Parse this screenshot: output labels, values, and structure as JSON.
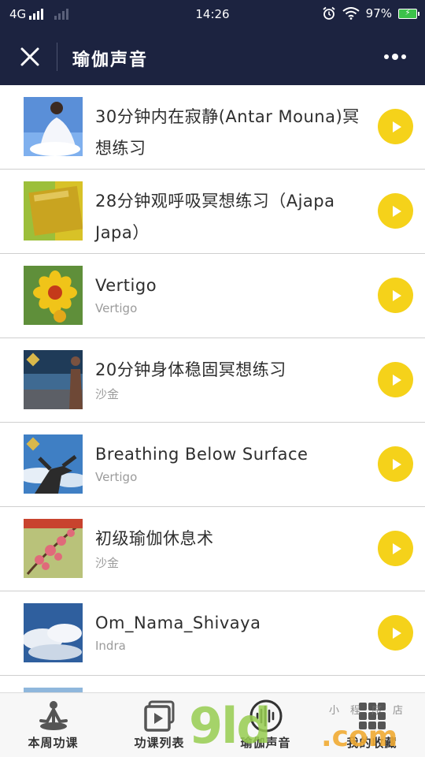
{
  "status_bar": {
    "network": "4G",
    "time": "14:26",
    "battery": "97%"
  },
  "header": {
    "title": "瑜伽声音"
  },
  "tracks": [
    {
      "title": "30分钟内在寂静(Antar Mouna)冥想练习",
      "subtitle": ""
    },
    {
      "title": "28分钟观呼吸冥想练习（Ajapa Japa）",
      "subtitle": ""
    },
    {
      "title": "Vertigo",
      "subtitle": "Vertigo"
    },
    {
      "title": "20分钟身体稳固冥想练习",
      "subtitle": "沙金"
    },
    {
      "title": "Breathing Below Surface",
      "subtitle": "Vertigo"
    },
    {
      "title": "初级瑜伽休息术",
      "subtitle": "沙金"
    },
    {
      "title": "Om_Nama_Shivaya",
      "subtitle": "Indra"
    }
  ],
  "tab_bar": {
    "tabs": [
      {
        "label": "本周功课",
        "icon": "meditation-figure-icon"
      },
      {
        "label": "功课列表",
        "icon": "video-play-icon"
      },
      {
        "label": "瑜伽声音",
        "icon": "sound-wave-icon"
      },
      {
        "label": "我的收藏",
        "icon": "grid-icon"
      }
    ]
  },
  "watermark": {
    "digits": "9ld",
    "suffix": ".com",
    "shop": "小程序店"
  },
  "colors": {
    "header_bg": "#1c2340",
    "play_button": "#f5d21a",
    "title_text": "#2e2e2e",
    "subtitle_text": "#9b9b9b"
  }
}
